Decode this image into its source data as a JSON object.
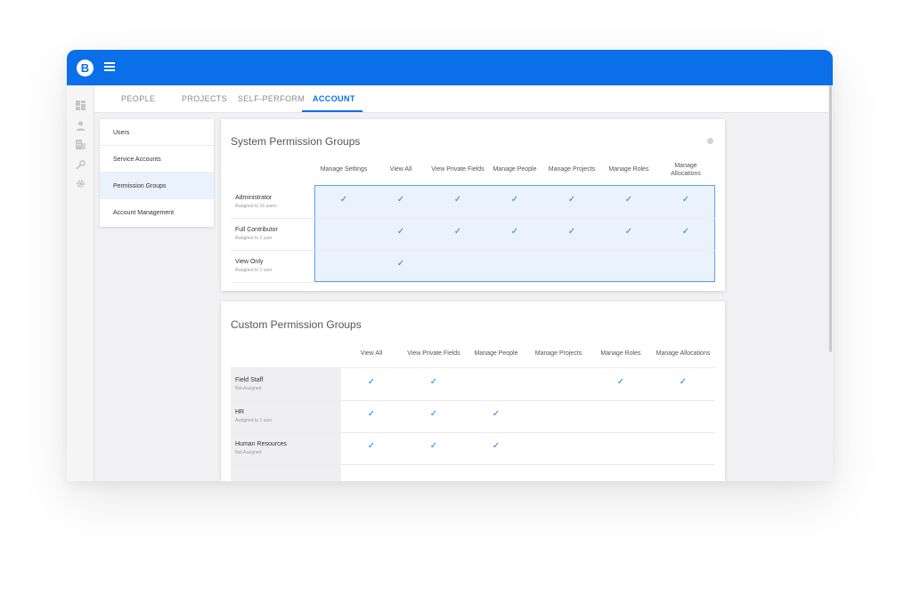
{
  "app": {
    "logo_letter": "B",
    "accent": "#0a6fe8"
  },
  "rail_icons": [
    "dashboard-icon",
    "person-icon",
    "building-icon",
    "wrench-icon",
    "gear-icon"
  ],
  "tabs": [
    {
      "label": "PEOPLE"
    },
    {
      "label": "PROJECTS"
    },
    {
      "label": "SELF-PERFORM"
    },
    {
      "label": "ACCOUNT",
      "active": true
    }
  ],
  "subnav": [
    {
      "label": "Users"
    },
    {
      "label": "Service Accounts"
    },
    {
      "label": "Permission Groups",
      "active": true
    },
    {
      "label": "Account Management"
    }
  ],
  "system_groups": {
    "title": "System Permission Groups",
    "columns": [
      "Manage Settings",
      "View All",
      "View Private Fields",
      "Manage People",
      "Manage Projects",
      "Manage Roles",
      "Manage Allocations"
    ],
    "rows": [
      {
        "name": "Administrator",
        "sub": "Assigned to 16 users",
        "checks": [
          true,
          true,
          true,
          true,
          true,
          true,
          true
        ]
      },
      {
        "name": "Full Contributor",
        "sub": "Assigned to 1 user",
        "checks": [
          false,
          true,
          true,
          true,
          true,
          true,
          true
        ]
      },
      {
        "name": "View Only",
        "sub": "Assigned to 1 user",
        "checks": [
          false,
          true,
          false,
          false,
          false,
          false,
          false
        ]
      }
    ]
  },
  "custom_groups": {
    "title": "Custom Permission Groups",
    "columns": [
      "View All",
      "View Private Fields",
      "Manage People",
      "Manage Projects",
      "Manage Roles",
      "Manage Allocations"
    ],
    "rows": [
      {
        "name": "Field Staff",
        "sub": "Not Assigned",
        "checks": [
          true,
          true,
          false,
          false,
          true,
          true
        ]
      },
      {
        "name": "HR",
        "sub": "Assigned to 1 user",
        "checks": [
          true,
          true,
          true,
          false,
          false,
          false
        ]
      },
      {
        "name": "Human Resources",
        "sub": "Not Assigned",
        "checks": [
          true,
          true,
          true,
          false,
          false,
          false
        ]
      }
    ]
  },
  "check_glyph": "✓"
}
